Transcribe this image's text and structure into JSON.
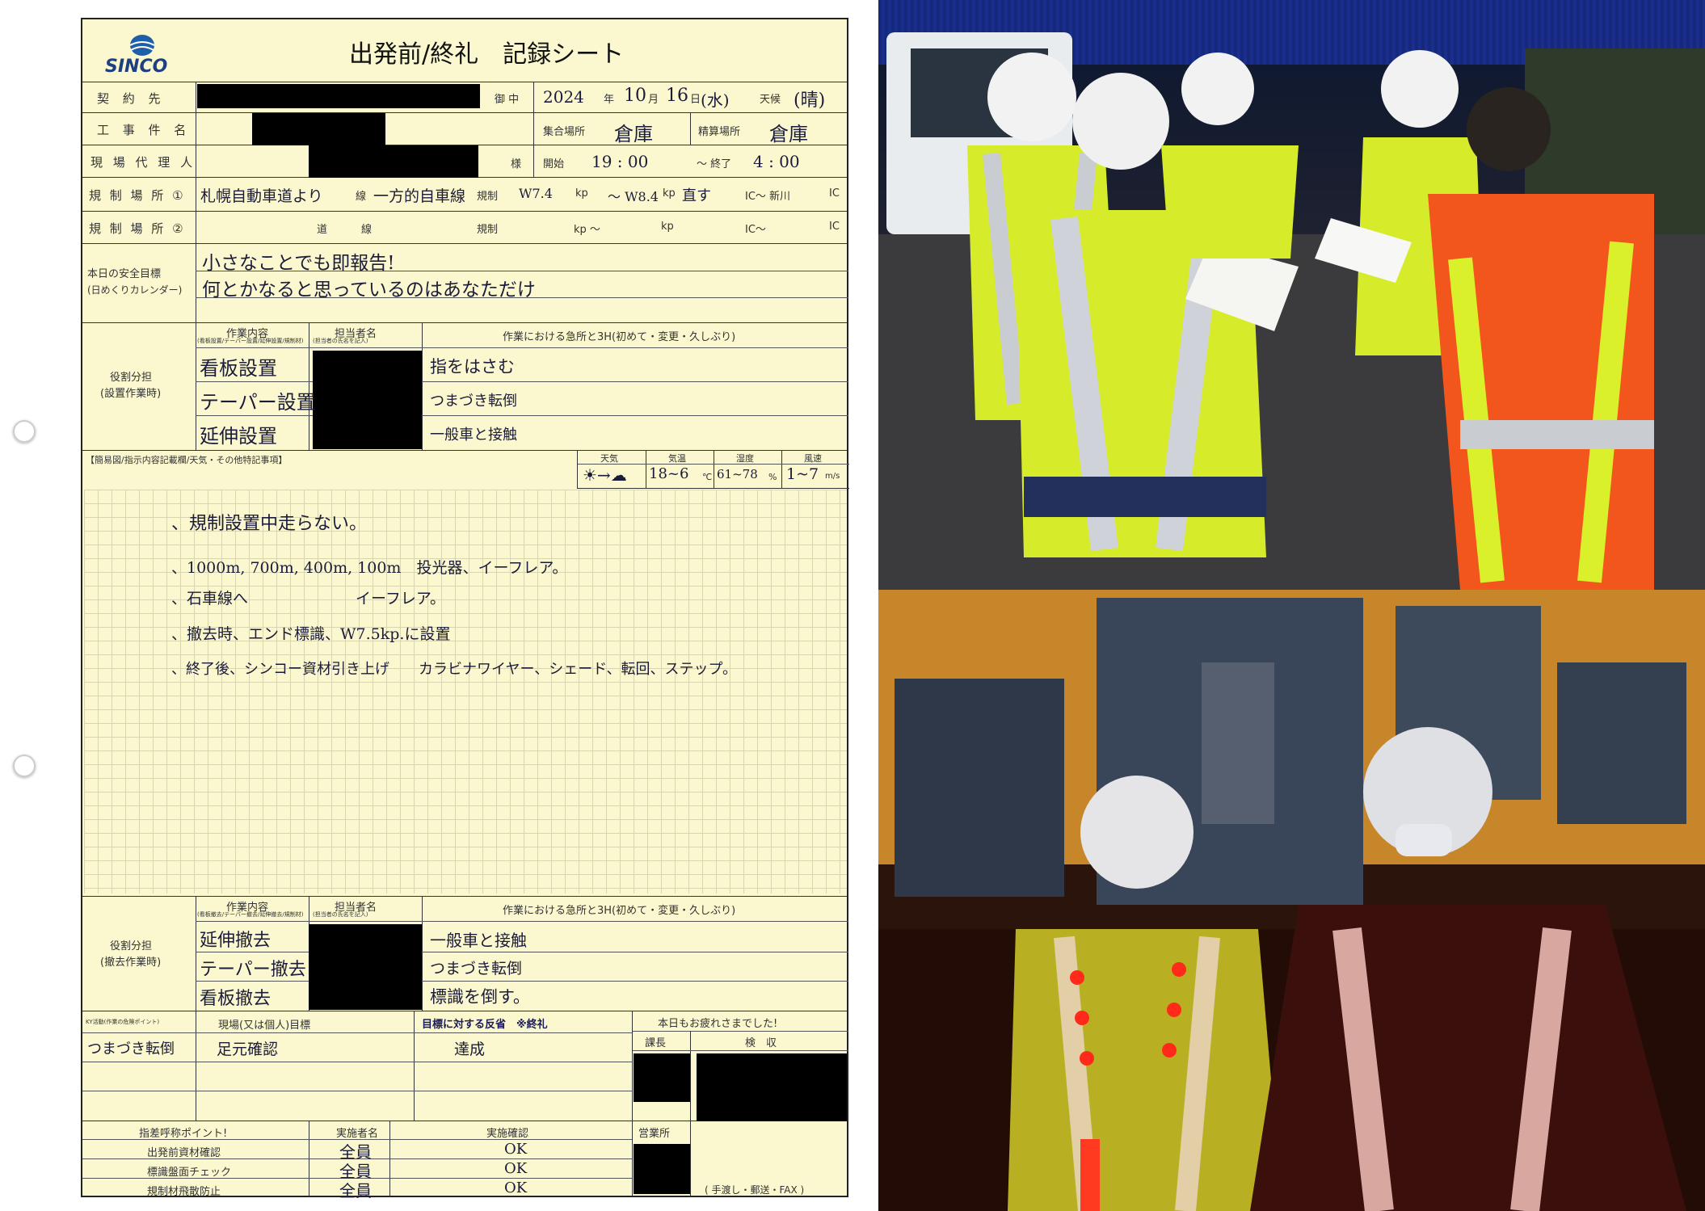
{
  "header": {
    "logo": "SINCO",
    "title": "出発前/終礼　記録シート"
  },
  "info": {
    "contract_label": "契 約 先",
    "onchu": "御 中",
    "date_year": "2024",
    "date_year_unit": "年",
    "date_month": "10",
    "date_month_unit": "月",
    "date_day": "16",
    "date_day_unit": "日",
    "date_weekday": "(水)",
    "weather_label": "天候",
    "weather_value": "(晴)",
    "project_label": "工 事 件 名",
    "meet_place_label": "集合場所",
    "meet_place_value": "倉庫",
    "finish_place_label": "精算場所",
    "finish_place_value": "倉庫",
    "agent_label": "現 場 代 理 人",
    "sama": "様",
    "start_label": "開始",
    "start_value": "19 : 00",
    "end_label": "〜 終了",
    "end_value": "4 : 00",
    "reg1_label": "規 制 場 所 ①",
    "reg1_road": "札幌自動車道より",
    "reg1_line_label": "線",
    "reg1_line": "一方的自車線",
    "reg1_kind_label": "規制",
    "reg1_kp_from": "W7.4",
    "reg1_kp_unit": "kp",
    "reg1_kp_to": "〜 W8.4",
    "reg1_kp_to_unit": "kp",
    "reg1_dir": "直す",
    "reg1_ic": "IC〜 新川",
    "reg1_ic_end": "IC",
    "reg2_label": "規 制 場 所 ②",
    "reg2_road": "道",
    "reg2_line": "線",
    "reg2_kind": "規制",
    "reg2_kp": "kp 〜",
    "reg2_kp2": "kp",
    "reg2_ic": "IC〜",
    "reg2_ic_end": "IC"
  },
  "safety": {
    "label_line1": "本日の安全目標",
    "label_line2": "(日めくりカレンダー)",
    "goal1": "小さなことでも即報告!",
    "goal2": "何とかなると思っているのはあなただけ"
  },
  "setup": {
    "label_line1": "役割分担",
    "label_line2": "(設置作業時)",
    "col_work": "作業内容",
    "col_work_sub": "(看板設置/テーパー設置/延伸設置/規制材)",
    "col_person": "担当者名",
    "col_person_sub": "(担当者の氏名を記入)",
    "col_danger": "作業における急所と3H(初めて・変更・久しぶり)",
    "rows": [
      {
        "work": "看板設置",
        "danger": "指をはさむ"
      },
      {
        "work": "テーパー設置",
        "danger": "つまづき転倒"
      },
      {
        "work": "延伸設置",
        "danger": "一般車と接触"
      }
    ]
  },
  "notes": {
    "label": "【簡易図/指示内容記載欄/天気・その他特記事項】",
    "weather_label": "天気",
    "temp_label": "気温",
    "humidity_label": "湿度",
    "wind_label": "風速",
    "weather_value": "☀→☁",
    "temp_value": "18~6",
    "temp_unit": "℃",
    "humidity_value": "61~78",
    "humidity_unit": "%",
    "wind_value": "1~7",
    "wind_unit": "m/s",
    "lines": [
      "、規制設置中走らない。",
      "、1000m, 700m, 400m, 100m　投光器、イーフレア。",
      "、石車線へ　　　　　　　イーフレア。",
      "、撤去時、エンド標識、W7.5kp.に設置",
      "、終了後、シンコー資材引き上げ　　カラビナワイヤー、シェード、転回、ステップ。"
    ]
  },
  "removal": {
    "label_line1": "役割分担",
    "label_line2": "(撤去作業時)",
    "col_work": "作業内容",
    "col_work_sub": "(看板撤去/テーパー撤去/延伸撤去/規制材)",
    "col_person": "担当者名",
    "col_person_sub": "(担当者の氏名を記入)",
    "col_danger": "作業における急所と3H(初めて・変更・久しぶり)",
    "rows": [
      {
        "work": "延伸撤去",
        "danger": "一般車と接触"
      },
      {
        "work": "テーパー撤去",
        "danger": "つまづき転倒"
      },
      {
        "work": "看板撤去",
        "danger": "標識を倒す。"
      }
    ]
  },
  "review": {
    "col1": "KY活動(作業の危険ポイント)",
    "col2": "現場(又は個人)目標",
    "col3": "目標に対する反省　※終礼",
    "col4": "本日もお疲れさまでした!",
    "row1_c1": "つまづき転倒",
    "row1_c2": "足元確認",
    "row1_c3": "達成",
    "boss_label": "課長",
    "check_label": "検　収",
    "sales_label": "営業所",
    "footer_note": "( 手渡し・郵送・FAX )"
  },
  "checks": {
    "col1": "指差呼称ポイント!",
    "col2": "実施者名",
    "col3": "実施確認",
    "rows": [
      {
        "item": "出発前資材確認",
        "who": "全員",
        "ok": "OK"
      },
      {
        "item": "標識盤面チェック",
        "who": "全員",
        "ok": "OK"
      },
      {
        "item": "規制材飛散防止",
        "who": "全員",
        "ok": "OK"
      }
    ]
  },
  "photos": {
    "top": {
      "description_icon": "workers-meeting-photo"
    },
    "bottom": {
      "description_icon": "workers-night-photo"
    }
  },
  "colors": {
    "paper": "#fbf8cf",
    "ink": "#1b1b3a",
    "hivis_yellow": "#d9ef2a",
    "hivis_orange": "#f2561c"
  }
}
